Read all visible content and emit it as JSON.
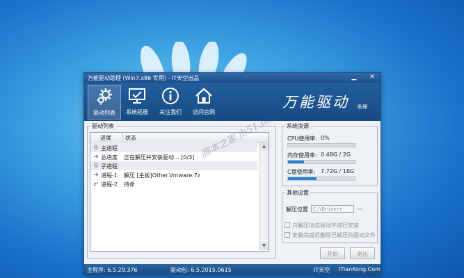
{
  "window": {
    "title": "万能驱动助理 (Win7.x86 专用) - IT天空出品",
    "controls": {
      "minimize": "▁",
      "close": "✕"
    }
  },
  "toolbar": {
    "items": [
      {
        "label": "驱动列表",
        "icon": "gears-icon",
        "active": true
      },
      {
        "label": "系统拓展",
        "icon": "monitor-check-icon",
        "active": false
      },
      {
        "label": "关注我们",
        "icon": "info-icon",
        "active": false
      },
      {
        "label": "访问官网",
        "icon": "home-icon",
        "active": false
      }
    ]
  },
  "brand": {
    "logo": "万能驱动",
    "sub": "助理"
  },
  "driver_list": {
    "legend": "驱动列表",
    "columns": [
      "进度",
      "状态"
    ],
    "rows": [
      {
        "icon": "gear-icon",
        "glyph": "⚙",
        "name": "主进程",
        "status": "",
        "shaded": true
      },
      {
        "icon": "arrow-right-icon",
        "glyph": "➜",
        "name": "总进度",
        "status": "正在解压并安装驱动... [0/3]",
        "shaded": false
      },
      {
        "icon": "gear-icon",
        "glyph": "⚙",
        "name": "子进程",
        "status": "",
        "shaded": true
      },
      {
        "icon": "arrow-right-icon",
        "glyph": "➜",
        "name": "进程-1",
        "status": "解压 [主板]Other.Vmware.7z",
        "shaded": false
      },
      {
        "icon": "sleep-icon",
        "glyph": "z²",
        "name": "进程-2",
        "status": "待命",
        "shaded": false
      }
    ]
  },
  "resources": {
    "legend": "系统资源",
    "cpu": {
      "label": "CPU使用率:",
      "value": "0%",
      "percent": 0
    },
    "memory": {
      "label": "内存使用率:",
      "value": "0.48G / 2G",
      "percent": 24
    },
    "disk": {
      "label": "C盘使用率:",
      "value": "7.72G / 18G",
      "percent": 43
    }
  },
  "other_settings": {
    "legend": "其他设置",
    "extract_label": "解压位置",
    "extract_path": "C:\\Drivers",
    "option1": "只解压动态驱动不进行安装",
    "option2": "安装完成后删除已解压的驱动文件"
  },
  "buttons": {
    "start": "开始",
    "exit": "退出"
  },
  "statusbar": {
    "main_program": "主程序: 6.5.29.376",
    "driver_pack": "驱动包: 6.5.2015.0615",
    "site_name": "IT天空",
    "site_url": "ITianKong.Com"
  },
  "watermark": "脚本之家 jb51.net",
  "colors": {
    "titlebar": "#1c4f8c",
    "accent": "#2f7fd1",
    "desktop": "#3ea3e2"
  }
}
